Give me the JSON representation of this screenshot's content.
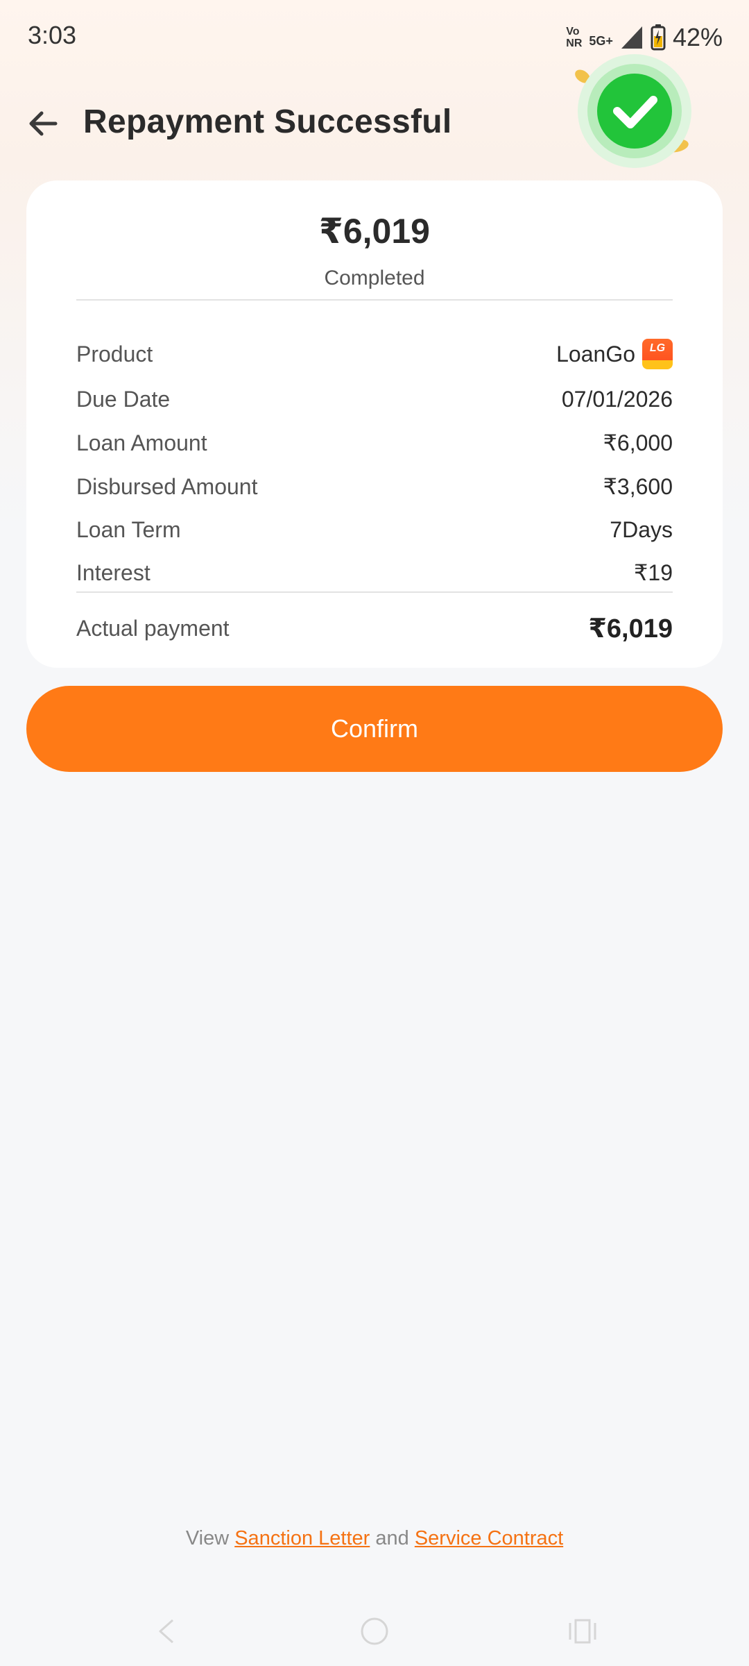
{
  "status_bar": {
    "time": "3:03",
    "volte_top": "Vo",
    "volte_bottom": "NR",
    "network": "5G+",
    "battery_percent": "42%"
  },
  "header": {
    "title": "Repayment Successful",
    "back_icon": "arrow-left-icon",
    "badge_icon": "check-circle-icon"
  },
  "summary": {
    "amount": "₹6,019",
    "status": "Completed"
  },
  "details": [
    {
      "label": "Product",
      "value": "LoanGo",
      "logo_text": "LG"
    },
    {
      "label": "Due Date",
      "value": "07/01/2026"
    },
    {
      "label": "Loan Amount",
      "value": "₹6,000"
    },
    {
      "label": "Disbursed Amount",
      "value": "₹3,600"
    },
    {
      "label": "Loan Term",
      "value": "7Days"
    },
    {
      "label": "Interest",
      "value": "₹19"
    }
  ],
  "actual_payment": {
    "label": "Actual payment",
    "value": "₹6,019"
  },
  "confirm_button": {
    "label": "Confirm"
  },
  "footer": {
    "prefix": "View",
    "sanction_letter": "Sanction Letter",
    "connector": "and",
    "service_contract": "Service Contract"
  },
  "colors": {
    "accent": "#ff7a16",
    "link": "#f57213",
    "success": "#22c43a"
  }
}
